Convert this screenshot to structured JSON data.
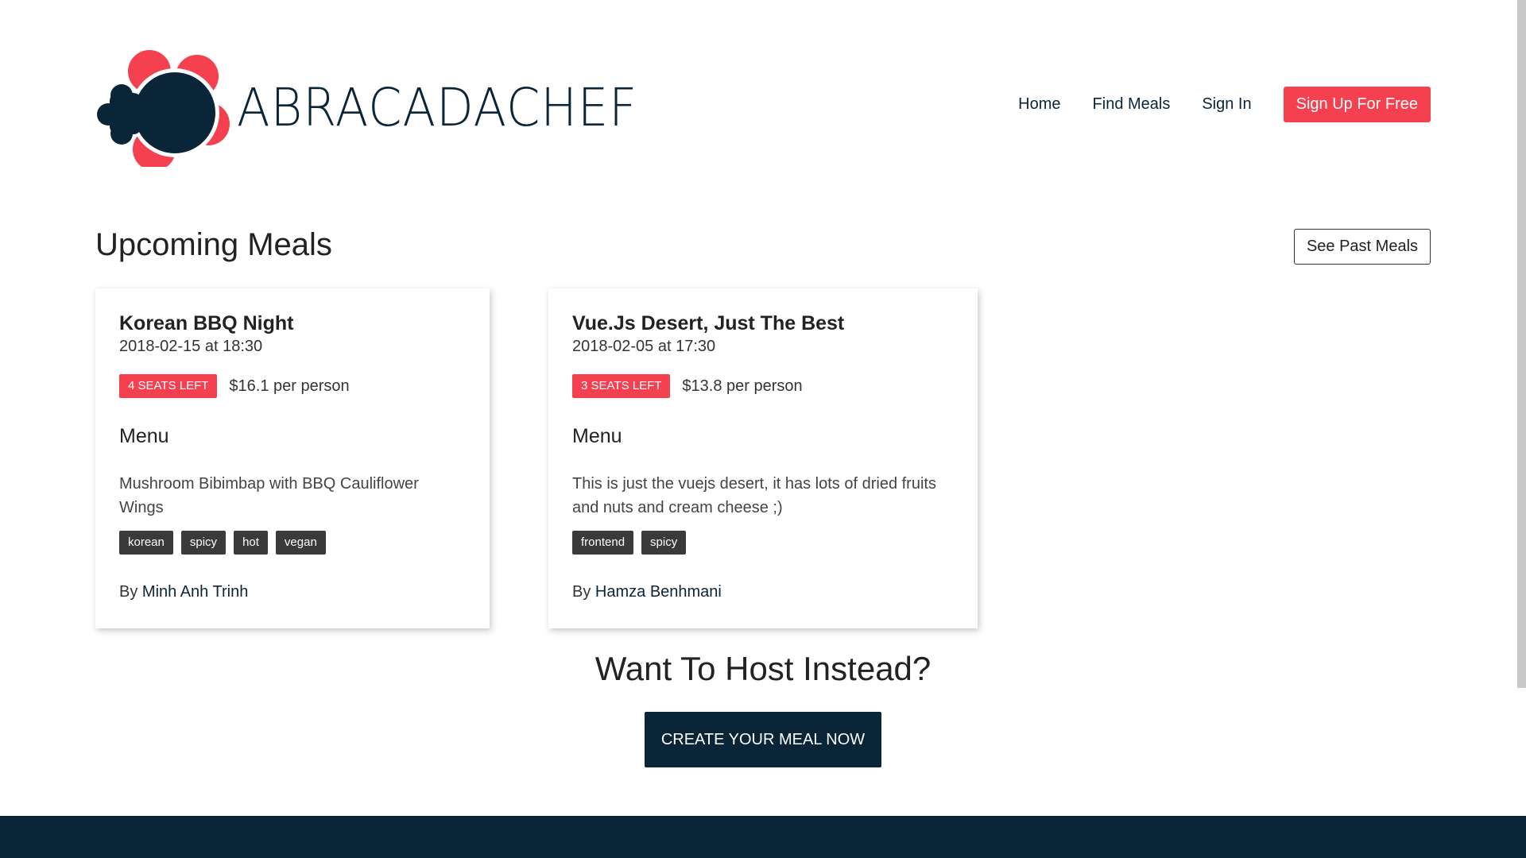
{
  "header": {
    "logo_text": "ABRACADACHEF",
    "nav": {
      "home": "Home",
      "find_meals": "Find Meals",
      "sign_in": "Sign In",
      "sign_up": "Sign Up For Free"
    }
  },
  "upcoming": {
    "title": "Upcoming Meals",
    "past_button": "See Past Meals"
  },
  "meals": [
    {
      "title": "Korean BBQ Night",
      "date": "2018-02-15 at 18:30",
      "seats": "4 SEATS LEFT",
      "price": "$16.1 per person",
      "menu_label": "Menu",
      "menu": "Mushroom Bibimbap with BBQ Cauliflower Wings",
      "tags": [
        "korean",
        "spicy",
        "hot",
        "vegan"
      ],
      "by": "By",
      "author": "Minh Anh Trinh"
    },
    {
      "title": "Vue.Js Desert, Just The Best",
      "date": "2018-02-05 at 17:30",
      "seats": "3 SEATS LEFT",
      "price": "$13.8 per person",
      "menu_label": "Menu",
      "menu": "This is just the vuejs desert, it has lots of dried fruits and nuts and cream cheese ;)",
      "tags": [
        "frontend",
        "spicy"
      ],
      "by": "By",
      "author": "Hamza Benhmani"
    }
  ],
  "host": {
    "title": "Want To Host Instead?",
    "button": "CREATE YOUR MEAL NOW"
  },
  "colors": {
    "accent": "#f5414f",
    "navy": "#0a2538",
    "tag": "#3a3a3a"
  },
  "icons": {
    "logo": "chef-hat-flower-logo"
  }
}
